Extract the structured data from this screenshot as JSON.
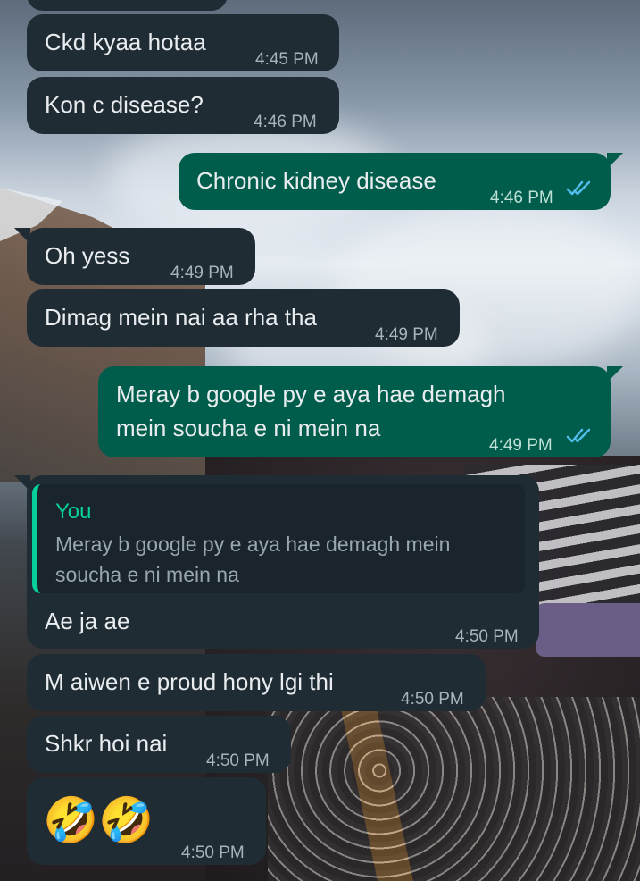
{
  "messages": [
    {
      "direction": "incoming",
      "text": "Ckd kyaa hotaa",
      "time": "4:45 PM"
    },
    {
      "direction": "incoming",
      "text": "Kon c disease?",
      "time": "4:46 PM"
    },
    {
      "direction": "outgoing",
      "text": "Chronic kidney disease",
      "time": "4:46 PM",
      "status": "read"
    },
    {
      "direction": "incoming",
      "text": "Oh yess",
      "time": "4:49 PM"
    },
    {
      "direction": "incoming",
      "text": "Dimag mein nai aa rha tha",
      "time": "4:49 PM"
    },
    {
      "direction": "outgoing",
      "text_line1": "Meray b google py e aya hae demagh",
      "text_line2": "mein soucha e ni mein na",
      "time": "4:49 PM",
      "status": "read"
    },
    {
      "direction": "incoming",
      "quote": {
        "author": "You",
        "text": "Meray b google py e aya hae demagh mein soucha e ni mein na"
      },
      "text": "Ae ja ae",
      "time": "4:50 PM"
    },
    {
      "direction": "incoming",
      "text": "M aiwen e proud hony lgi thi",
      "time": "4:50 PM"
    },
    {
      "direction": "incoming",
      "text": "Shkr hoi nai",
      "time": "4:50 PM"
    },
    {
      "direction": "incoming",
      "text": "🤣🤣",
      "time": "4:50 PM"
    }
  ],
  "colors": {
    "incoming_bubble": "#1f2c34",
    "outgoing_bubble": "#005c4b",
    "quote_accent": "#06cf9c",
    "read_ticks": "#53bdeb"
  },
  "icons": {
    "read_status": "double-check-icon"
  }
}
